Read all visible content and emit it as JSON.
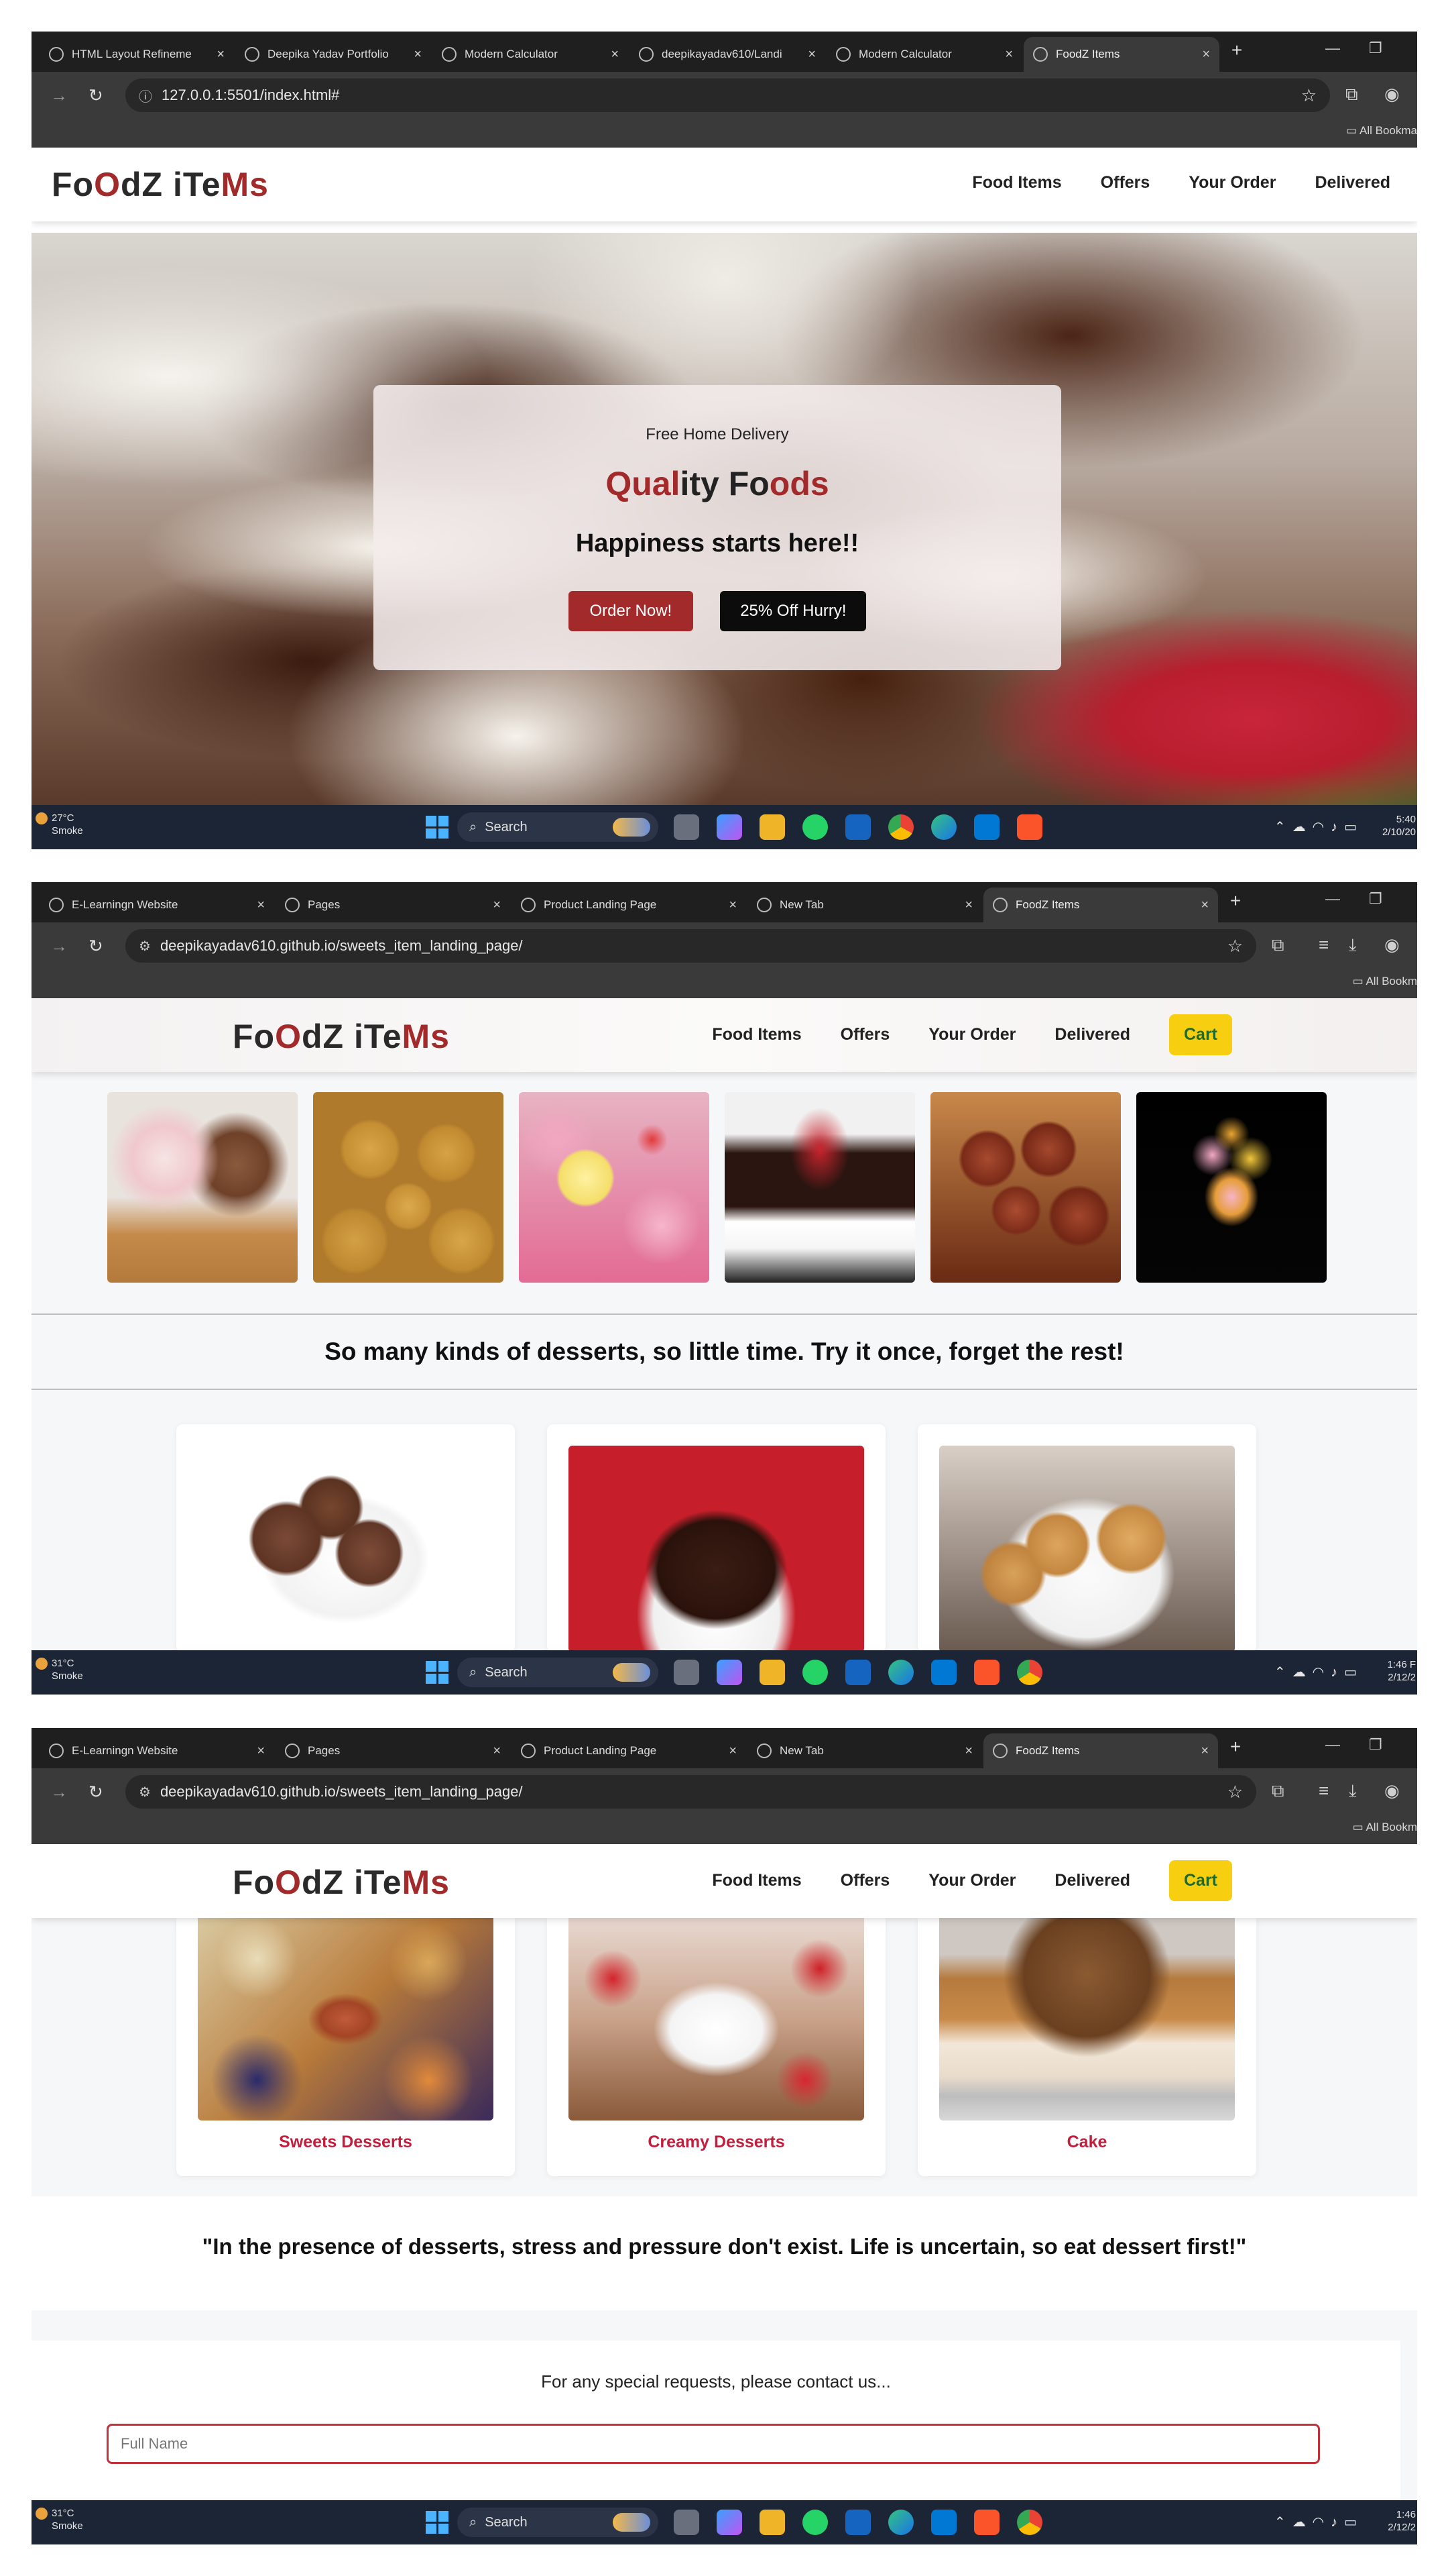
{
  "shots": [
    {
      "tabs": [
        "HTML Layout Refineme",
        "Deepika Yadav Portfolio",
        "Modern Calculator",
        "deepikayadav610/Landi",
        "Modern Calculator",
        "FoodZ Items"
      ],
      "url": "127.0.0.1:5501/index.html#",
      "bookmarks_folder": "All Bookma",
      "weather": {
        "temp": "27°C",
        "cond": "Smoke"
      },
      "clock": {
        "time": "5:40",
        "date": "2/10/20"
      }
    },
    {
      "tabs": [
        "E-Learningn Website",
        "Pages",
        "Product Landing Page",
        "New Tab",
        "FoodZ Items"
      ],
      "url": "deepikayadav610.github.io/sweets_item_landing_page/",
      "bookmarks_folder": "All Bookm",
      "weather": {
        "temp": "31°C",
        "cond": "Smoke"
      },
      "clock": {
        "time": "1:46 F",
        "date": "2/12/2"
      }
    },
    {
      "tabs": [
        "E-Learningn Website",
        "Pages",
        "Product Landing Page",
        "New Tab",
        "FoodZ Items"
      ],
      "url": "deepikayadav610.github.io/sweets_item_landing_page/",
      "bookmarks_folder": "All Bookm",
      "weather": {
        "temp": "31°C",
        "cond": "Smoke"
      },
      "clock": {
        "time": "1:46",
        "date": "2/12/2"
      }
    }
  ],
  "taskbar": {
    "search": "Search"
  },
  "site": {
    "logo": {
      "p1": "Fo",
      "p2": "O",
      "p3": "dZ iTe",
      "p4": "Ms"
    },
    "nav": [
      "Food Items",
      "Offers",
      "Your Order",
      "Delivered"
    ],
    "cart": "Cart"
  },
  "hero": {
    "subtitle": "Free Home Delivery",
    "title_parts": [
      "Qual",
      "ity Fo",
      "ods"
    ],
    "tagline": "Happiness starts here!!",
    "btn_order": "Order Now!",
    "btn_offer": "25% Off Hurry!"
  },
  "gallery": {
    "thumbs": [
      "ice-cream-cones",
      "laddoo",
      "cupcakes",
      "chocolate-cake",
      "gulab-jamun",
      "sundae"
    ],
    "tagline": "So many kinds of desserts, so little time. Try it once, forget the rest!"
  },
  "categories": [
    {
      "label": "Sweets Desserts"
    },
    {
      "label": "Creamy Desserts"
    },
    {
      "label": "Cake"
    }
  ],
  "quote": "\"In the presence of desserts, stress and pressure don't exist. Life is uncertain, so eat dessert first!\"",
  "contact": {
    "text": "For any special requests, please contact us...",
    "name_placeholder": "Full Name"
  },
  "colors": {
    "brand_red": "#a32a2a",
    "label_red": "#c21f3f",
    "cart_yellow": "#f7cf10"
  }
}
